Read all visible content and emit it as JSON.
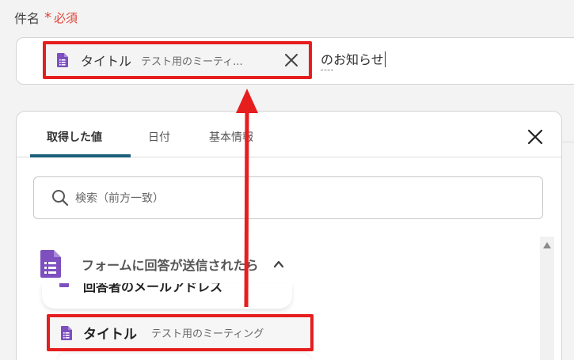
{
  "field": {
    "label": "件名",
    "required_label": "必須",
    "required_mark": "*"
  },
  "subject": {
    "chip": {
      "label": "タイトル",
      "value": "テスト用のミーティ..."
    },
    "text_before_caret": "の",
    "text_after": "お知らせ"
  },
  "panel": {
    "tabs": [
      {
        "label": "取得した値",
        "active": true
      },
      {
        "label": "日付",
        "active": false
      },
      {
        "label": "基本情報",
        "active": false
      }
    ],
    "search": {
      "placeholder": "検索（前方一致）"
    },
    "section": {
      "label": "フォームに回答が送信されたら"
    },
    "partial_item": {
      "label": "回答者のメールアドレス"
    },
    "item": {
      "label": "タイトル",
      "value": "テスト用のミーティング"
    }
  },
  "colors": {
    "highlight_red": "#e61e1e",
    "tab_accent": "#1d5f7a",
    "required_red": "#e0463c",
    "google_forms_purple": "#7d4fbf"
  },
  "icons": {
    "chip_icon": "google-forms-icon",
    "close": "close-icon",
    "search": "search-icon",
    "section": "google-forms-icon",
    "collapse": "chevron-up-icon",
    "scroll_up": "scroll-up-arrow-icon",
    "arrow": "red-arrow-annotation"
  }
}
